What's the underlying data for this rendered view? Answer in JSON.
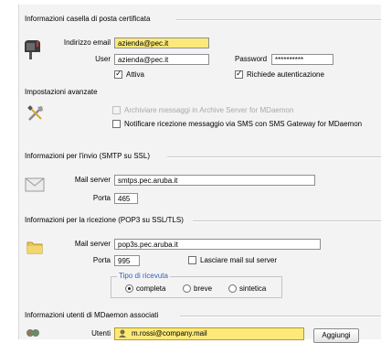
{
  "sections": {
    "pec": {
      "title": "Informazioni casella di posta certificata"
    },
    "advanced": {
      "title": "Impostazioni avanzate"
    },
    "smtp": {
      "title": "Informazioni per l'invio (SMTP su SSL)"
    },
    "pop3": {
      "title": "Informazioni per la ricezione (POP3 su SSL/TLS)"
    },
    "users": {
      "title": "Informazioni utenti di MDaemon associati"
    }
  },
  "pec": {
    "email_label": "Indirizzo email",
    "email_value": "azienda@pec.it",
    "user_label": "User",
    "user_value": "azienda@pec.it",
    "password_label": "Password",
    "password_value": "**********",
    "active_label": "Attiva",
    "active_checked": true,
    "auth_label": "Richiede autenticazione",
    "auth_checked": true
  },
  "advanced": {
    "archive_label": "Archiviare messaggi in Archive Server for MDaemon",
    "archive_checked": false,
    "archive_disabled": true,
    "sms_label": "Notificare ricezione messaggio via SMS con SMS Gateway for MDaemon",
    "sms_checked": false
  },
  "smtp": {
    "server_label": "Mail server",
    "server_value": "smtps.pec.aruba.it",
    "port_label": "Porta",
    "port_value": "465"
  },
  "pop3": {
    "server_label": "Mail server",
    "server_value": "pop3s.pec.aruba.it",
    "port_label": "Porta",
    "port_value": "995",
    "keep_label": "Lasciare mail sul server",
    "keep_checked": false,
    "receipt_group_title": "Tipo di ricevuta",
    "receipt_options": [
      "completa",
      "breve",
      "sintetica"
    ],
    "receipt_selected": "completa"
  },
  "users": {
    "users_label": "Utenti",
    "first_user": "m.rossi@company.mail",
    "add_button": "Aggiungi"
  }
}
